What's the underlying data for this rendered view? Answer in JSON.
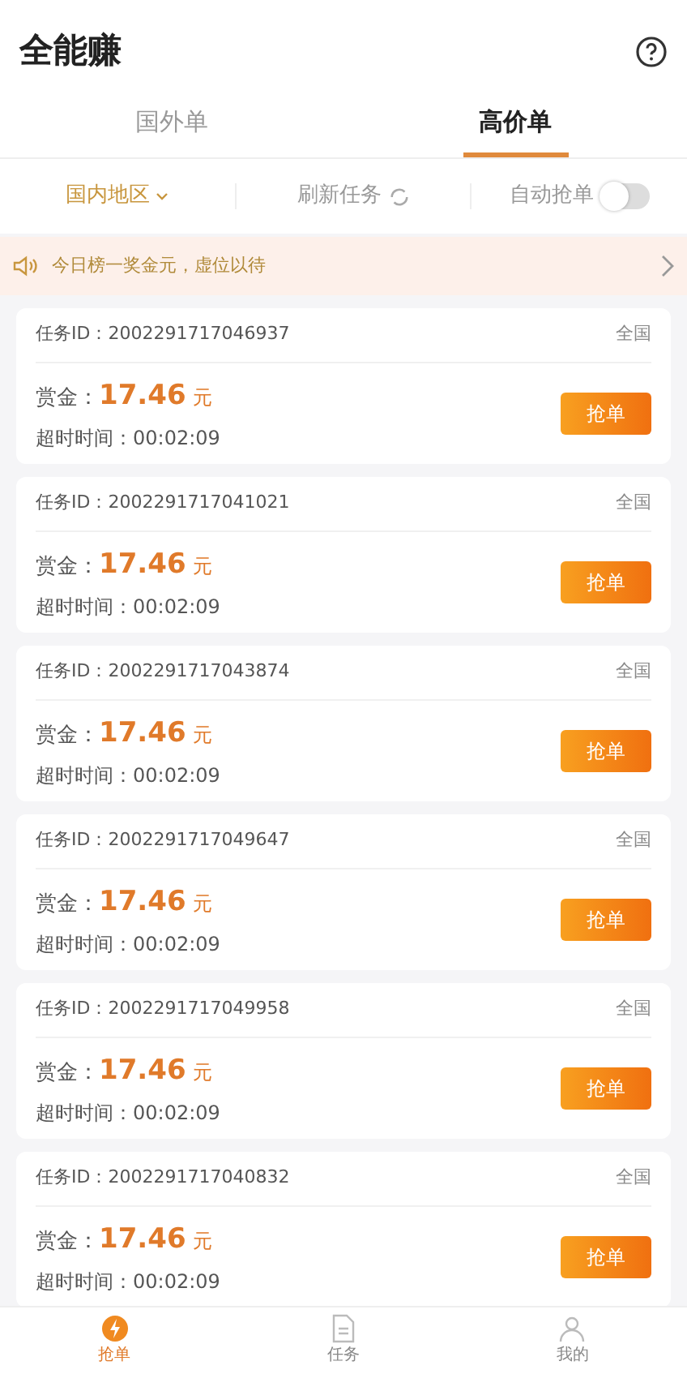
{
  "header": {
    "title": "全能赚"
  },
  "tabs": [
    {
      "label": "国外单",
      "selected": false
    },
    {
      "label": "高价单",
      "selected": true
    }
  ],
  "filters": {
    "region": "国内地区",
    "refresh": "刷新任务",
    "auto_grab": {
      "label": "自动抢单",
      "on": false
    }
  },
  "notice": "今日榜一奖金元，虚位以待",
  "tasks": [
    {
      "id": "任务ID：2002291717046937",
      "area": "全国",
      "reward_label": "赏金：",
      "amount": "17.46",
      "unit": "元",
      "timeout": "超时时间：00:02:09",
      "button": "抢单"
    },
    {
      "id": "任务ID：2002291717041021",
      "area": "全国",
      "reward_label": "赏金：",
      "amount": "17.46",
      "unit": "元",
      "timeout": "超时时间：00:02:09",
      "button": "抢单"
    },
    {
      "id": "任务ID：2002291717043874",
      "area": "全国",
      "reward_label": "赏金：",
      "amount": "17.46",
      "unit": "元",
      "timeout": "超时时间：00:02:09",
      "button": "抢单"
    },
    {
      "id": "任务ID：2002291717049647",
      "area": "全国",
      "reward_label": "赏金：",
      "amount": "17.46",
      "unit": "元",
      "timeout": "超时时间：00:02:09",
      "button": "抢单"
    },
    {
      "id": "任务ID：2002291717049958",
      "area": "全国",
      "reward_label": "赏金：",
      "amount": "17.46",
      "unit": "元",
      "timeout": "超时时间：00:02:09",
      "button": "抢单"
    },
    {
      "id": "任务ID：2002291717040832",
      "area": "全国",
      "reward_label": "赏金：",
      "amount": "17.46",
      "unit": "元",
      "timeout": "超时时间：00:02:09",
      "button": "抢单"
    }
  ],
  "bottom_nav": [
    {
      "label": "抢单",
      "kind": "grab",
      "selected": true
    },
    {
      "label": "任务",
      "kind": "tasks",
      "selected": false
    },
    {
      "label": "我的",
      "kind": "me",
      "selected": false
    }
  ]
}
